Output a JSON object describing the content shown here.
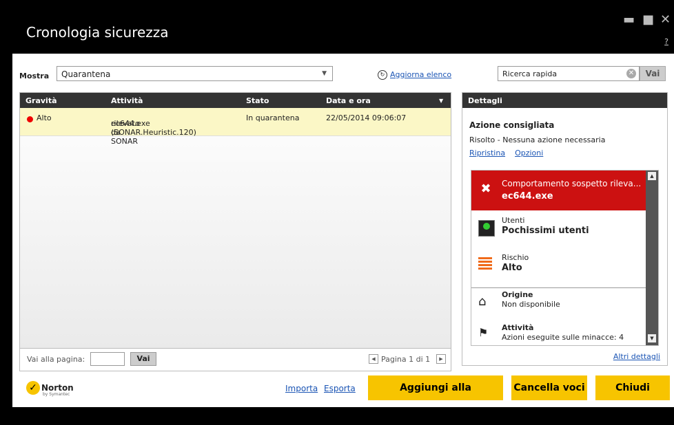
{
  "window": {
    "title": "Cronologia sicurezza",
    "help": "?"
  },
  "toolbar": {
    "show_label": "Mostra",
    "show_value": "Quarantena",
    "refresh_label": "Aggiorna elenco",
    "search_placeholder": "Ricerca rapida",
    "search_button": "Vai"
  },
  "table": {
    "columns": [
      "Gravità",
      "Attività",
      "Stato",
      "Data e ora"
    ],
    "rows": [
      {
        "severity": "Alto",
        "activity_line1": "ec644.exe (SONAR.Heuristic.120)",
        "activity_line2": "rilevato da SONAR",
        "status": "In quarantena",
        "datetime": "22/05/2014 09:06:07"
      }
    ]
  },
  "pager": {
    "goto_label": "Vai alla pagina:",
    "goto_button": "Vai",
    "page_text": "Pagina 1 di 1"
  },
  "details": {
    "header": "Dettagli",
    "recommended_title": "Azione consigliata",
    "recommended_text": "Risolto - Nessuna azione necessaria",
    "restore_link": "Ripristina",
    "options_link": "Opzioni",
    "threat_line1": "Comportamento sospetto rileva...",
    "threat_line2": "ec644.exe",
    "users_label": "Utenti",
    "users_value": "Pochissimi utenti",
    "risk_label": "Rischio",
    "risk_value": "Alto",
    "origin_label": "Origine",
    "origin_value": "Non disponibile",
    "activity_label": "Attività",
    "activity_value": "Azioni eseguite sulle minacce: 4",
    "more_link": "Altri dettagli"
  },
  "footer": {
    "brand": "Norton",
    "brand_sub": "by Symantec",
    "import_link": "Importa",
    "export_link": "Esporta",
    "quarantine_button": "Aggiungi alla quarantena",
    "clear_button": "Cancella voci",
    "close_button": "Chiudi"
  },
  "colors": {
    "accent": "#f7c400",
    "threat": "#cc1111",
    "header": "#333333",
    "row_highlight": "#fbf7c6"
  }
}
